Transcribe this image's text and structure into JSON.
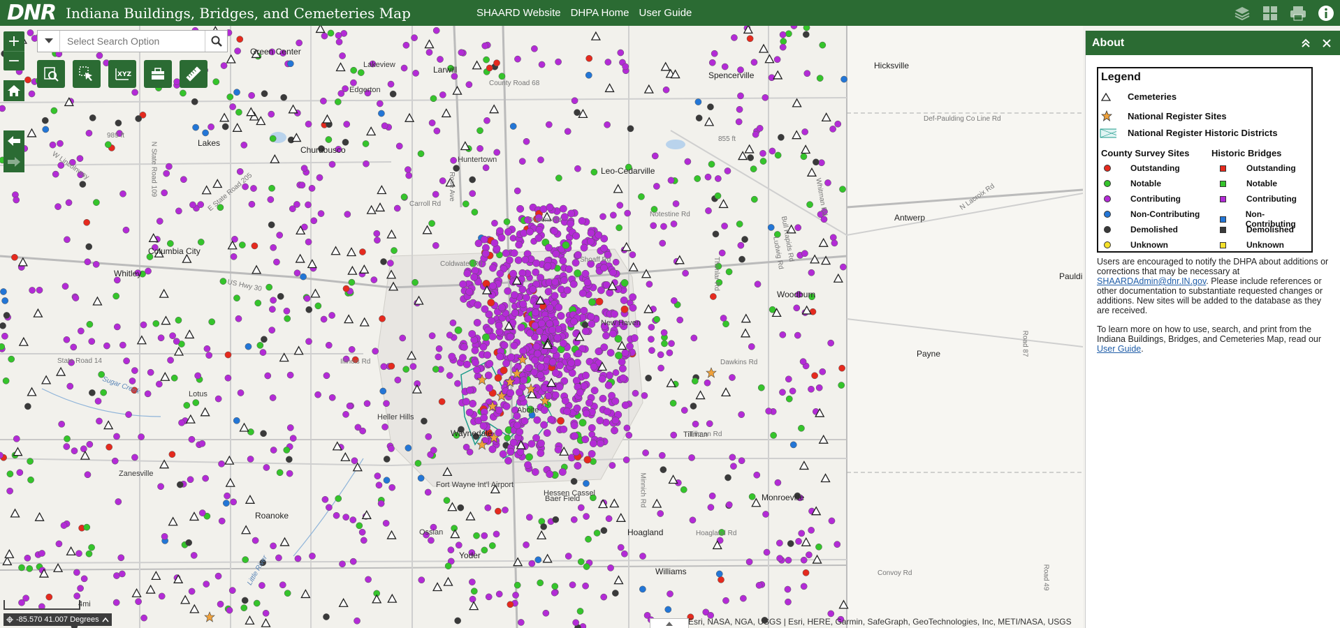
{
  "header": {
    "logo": "DNR",
    "title": "Indiana Buildings, Bridges, and Cemeteries Map",
    "links": [
      "SHAARD Website",
      "DHPA Home",
      "User Guide"
    ],
    "tools": [
      "layers-icon",
      "basemap-gallery-icon",
      "print-icon",
      "info-icon"
    ],
    "color": "#2b6b33"
  },
  "map": {
    "search": {
      "placeholder": "Select Search Option"
    },
    "zoom_in": "+",
    "zoom_out": "−",
    "coords": "-85.570 41.007 Degrees",
    "scale_label": "4mi",
    "attribution": "Esri, NASA, NGA, USGS | Esri, HERE, Garmin, SafeGraph, GeoTechnologies, Inc, METI/NASA, USGS",
    "places": [
      "Green Center",
      "Lakes",
      "Churubusco",
      "Columbia City",
      "Whitley",
      "Larwill",
      "Lakeview",
      "Spencerville",
      "Leo-Cedarville",
      "Antwerp",
      "Hicksville",
      "Payne",
      "Woodburn",
      "Waynedale",
      "Roanoke",
      "Monroeville",
      "Hoagland",
      "Yoder",
      "Williams",
      "Huntertown",
      "New Haven",
      "Aboite",
      "Fort Wayne Int'l Airport",
      "Paulding",
      "Baer Field",
      "Zanesville",
      "Ossian",
      "Edgerton",
      "Lotus",
      "Hessen Cassel",
      "Heller Hills",
      "Tillman"
    ],
    "roads": [
      "W Lincolnway",
      "E State Road 205",
      "Carroll Rd",
      "Dupont Rd",
      "Shoaff Rd",
      "Coldwater Rd",
      "US Hwy 30",
      "Illinois Rd",
      "Dawkins Rd",
      "Tillman Rd",
      "Hoagland Rd",
      "Convoy Rd",
      "County Road 68",
      "Def-Paulding Co Line Rd",
      "State Road 14",
      "Sugar Creek",
      "N State Road 109",
      "N Lacroix Rd",
      "Minnich Rd",
      "Whitman Rd",
      "Ludwig Rd",
      "Thimlar Rd",
      "Notestine Rd",
      "Rose Ave",
      "Bull Rapids Rd",
      "Road 87",
      "Road 49",
      "Little River"
    ],
    "elevations": [
      "989 ft",
      "855 ft"
    ],
    "shields": [
      "33",
      "30",
      "69",
      "24",
      "114",
      "127"
    ]
  },
  "about": {
    "title": "About",
    "legend": {
      "title": "Legend",
      "cemeteries": "Cemeteries",
      "national_register_sites": "National Register Sites",
      "historic_districts": "National Register Historic Districts",
      "county_survey_title": "County Survey Sites",
      "historic_bridges_title": "Historic Bridges",
      "categories": [
        {
          "label": "Outstanding",
          "color": "#e52a1e"
        },
        {
          "label": "Notable",
          "color": "#35c42b"
        },
        {
          "label": "Contributing",
          "color": "#b32bd6"
        },
        {
          "label": "Non-Contributing",
          "color": "#2376d6"
        },
        {
          "label": "Demolished",
          "color": "#3a3a3a"
        },
        {
          "label": "Unknown",
          "color": "#f5e12a"
        }
      ]
    },
    "paragraph1_a": "Users are encouraged to notify the DHPA about additions or corrections that may be necessary at ",
    "email": "SHAARDAdmin@dnr.IN.gov",
    "paragraph1_b": ". Please include references or other documentation to substantiate requested changes or additions. New sites will be added to the database as they are received.",
    "paragraph2_a": "To learn more on how to use, search, and print from the Indiana Buildings, Bridges, and Cemeteries Map, read our ",
    "guide_link": "User Guide",
    "paragraph2_b": "."
  }
}
